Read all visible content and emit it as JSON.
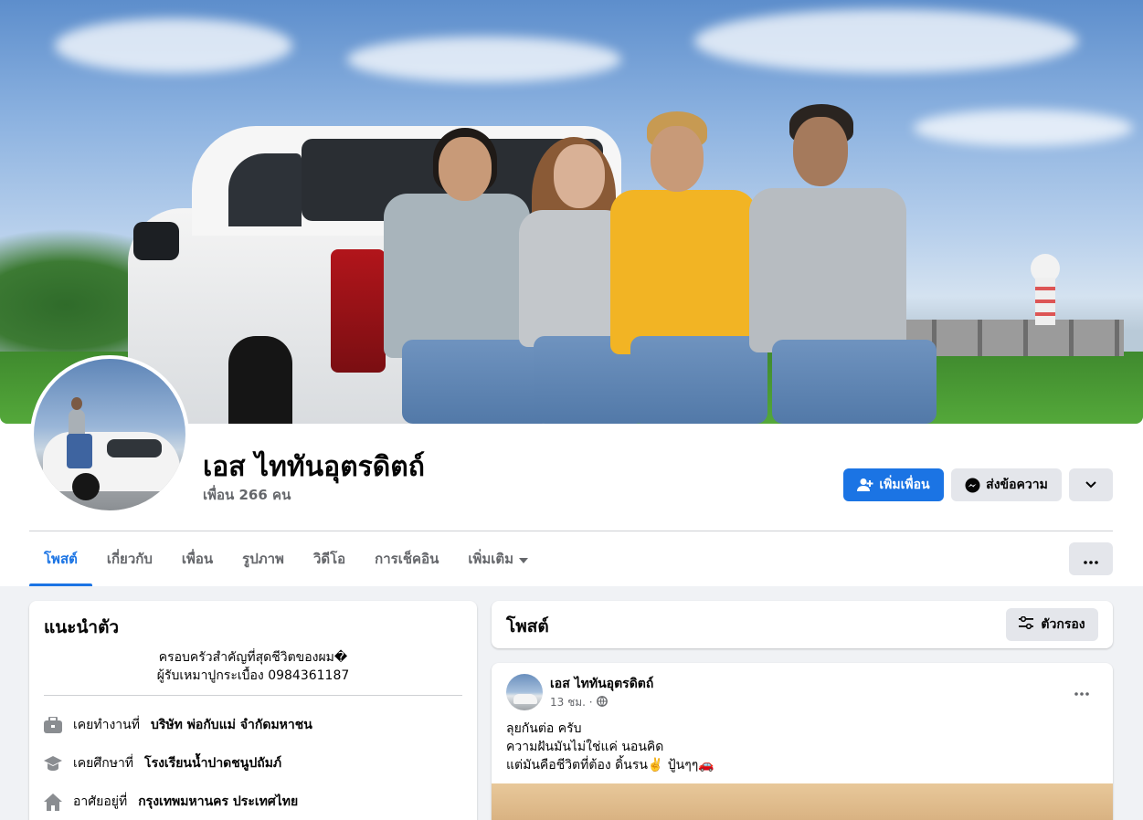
{
  "profile": {
    "name": "เอส ไททันอุตรดิตถ์",
    "friends_count": "เพื่อน 266 คน"
  },
  "actions": {
    "add_friend_label": "เพิ่มเพื่อน",
    "message_label": "ส่งข้อความ",
    "add_friend_icon": "person-add-icon",
    "message_icon": "messenger-icon",
    "more_icon": "chevron-down-icon"
  },
  "tabs": [
    {
      "label": "โพสต์",
      "active": true
    },
    {
      "label": "เกี่ยวกับ",
      "active": false
    },
    {
      "label": "เพื่อน",
      "active": false
    },
    {
      "label": "รูปภาพ",
      "active": false
    },
    {
      "label": "วิดีโอ",
      "active": false
    },
    {
      "label": "การเช็คอิน",
      "active": false
    },
    {
      "label": "เพิ่มเติม",
      "active": false
    }
  ],
  "intro": {
    "title": "แนะนำตัว",
    "bio_line1": "ครอบครัวสำคัญที่สุดชีวิตของผม�",
    "bio_line2": "ผู้รับเหมาปูกระเบื้อง 0984361187",
    "work_prefix": "เคยทำงานที่",
    "work_value": "บริษัท พ่อกับแม่ จำกัดมหาชน",
    "education_prefix": "เคยศึกษาที่",
    "education_value": "โรงเรียนน้ำปาดชนูปถัมภ์",
    "lives_prefix": "อาศัยอยู่ที่",
    "lives_value": "กรุงเทพมหานคร ประเทศไทย"
  },
  "posts_header": {
    "title": "โพสต์",
    "filter_label": "ตัวกรอง",
    "filter_icon": "filter-sliders-icon"
  },
  "post": {
    "author": "เอส ไททันอุตรดิตถ์",
    "time": "13 ชม. ·",
    "privacy_icon": "globe-icon",
    "line1": "ลุยกันต่อ ครับ",
    "line2": "ความฝันมันไม่ใช่แค่ นอนคิด",
    "line3": "แต่มันคือชีวิตที่ต้อง ดิ้นรน✌️ ปู้นๆๆ🚗"
  },
  "colors": {
    "accent": "#1b74e4",
    "secondary_button": "#e4e6eb",
    "page_background": "#f0f2f5",
    "muted_text": "#65676b"
  }
}
